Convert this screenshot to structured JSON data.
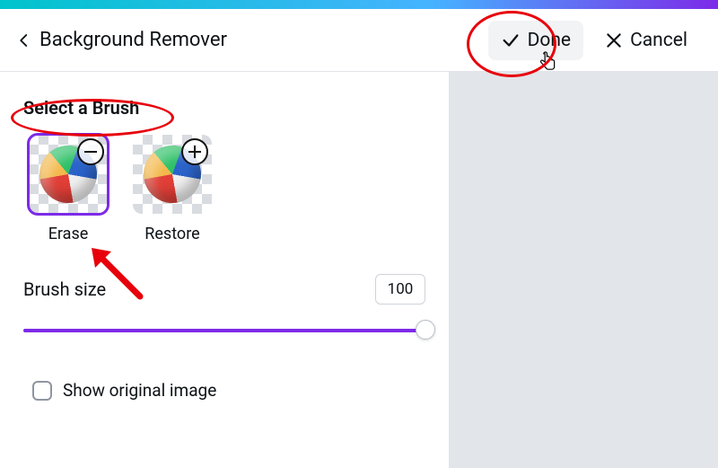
{
  "header": {
    "title": "Background Remover",
    "done_label": "Done",
    "cancel_label": "Cancel"
  },
  "panel": {
    "section_title": "Select a Brush",
    "brushes": {
      "erase": {
        "label": "Erase",
        "badge": "minus",
        "selected": true
      },
      "restore": {
        "label": "Restore",
        "badge": "plus",
        "selected": false
      }
    },
    "brush_size": {
      "label": "Brush size",
      "value": "100",
      "percent": 100
    },
    "show_original": {
      "label": "Show original image",
      "checked": false
    }
  },
  "annotations": {
    "done_circle": true,
    "title_oval": true,
    "erase_arrow": true
  }
}
